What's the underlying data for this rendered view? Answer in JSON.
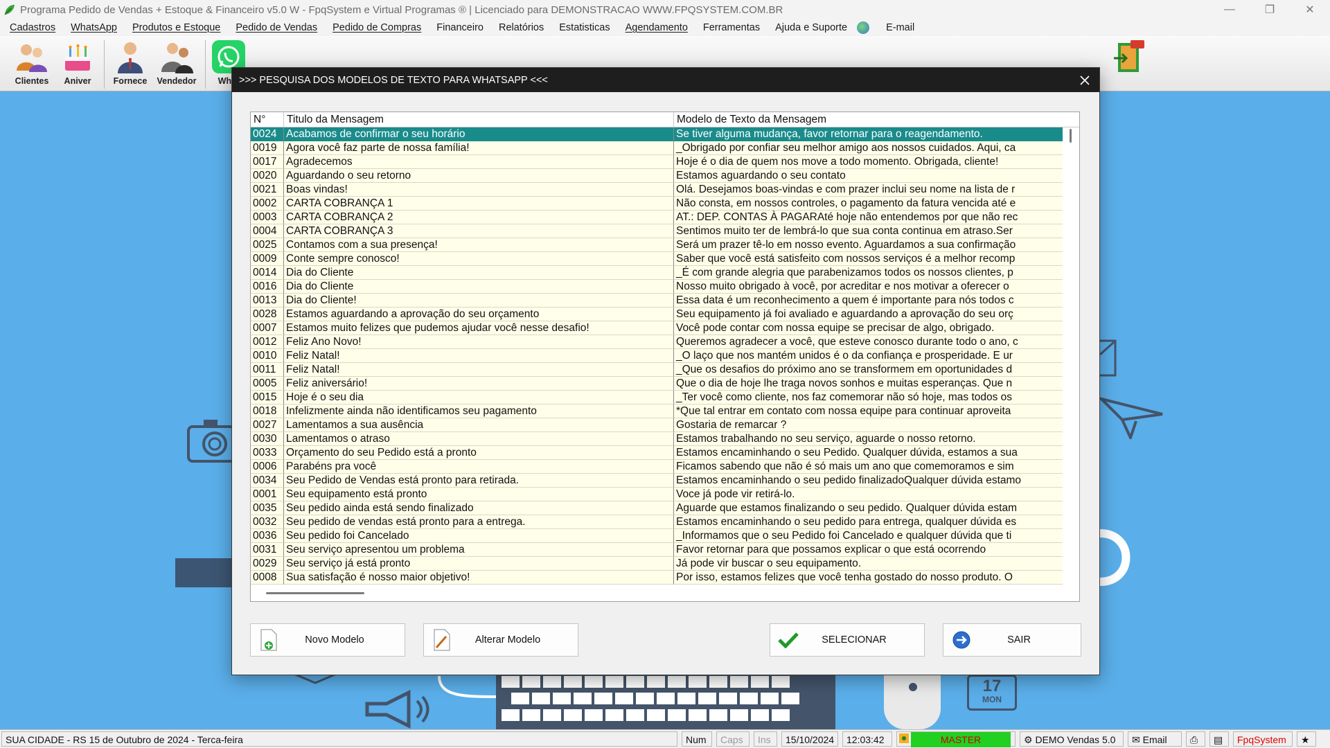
{
  "window": {
    "title": "Programa Pedido de Vendas + Estoque & Financeiro v5.0 W - FpqSystem e Virtual Programas ® | Licenciado para  DEMONSTRACAO WWW.FPQSYSTEM.COM.BR"
  },
  "menu": [
    "Cadastros",
    "WhatsApp",
    "Produtos e Estoque",
    "Pedido de Vendas",
    "Pedido de Compras",
    "Financeiro",
    "Relatórios",
    "Estatisticas",
    "Agendamento",
    "Ferramentas",
    "Ajuda e Suporte",
    "E-mail"
  ],
  "toolbar": {
    "clientes": "Clientes",
    "aniver": "Aniver",
    "fornece": "Fornece",
    "vendedor": "Vendedor",
    "whats": "What"
  },
  "dialog": {
    "title": ">>> PESQUISA DOS MODELOS DE TEXTO PARA WHATSAPP <<<",
    "columns": [
      "N°",
      "Titulo da Mensagem",
      "Modelo de Texto da Mensagem"
    ],
    "selected_index": 0,
    "rows": [
      {
        "n": "0024",
        "titulo": "Acabamos de confirmar o seu horário",
        "texto": "Se tiver alguma mudança, favor retornar para o reagendamento."
      },
      {
        "n": "0019",
        "titulo": "Agora você faz parte de nossa família!",
        "texto": "_Obrigado por confiar seu melhor amigo aos nossos cuidados. Aqui, ca"
      },
      {
        "n": "0017",
        "titulo": "Agradecemos",
        "texto": "Hoje é o dia de quem nos move a todo momento. Obrigada, cliente!"
      },
      {
        "n": "0020",
        "titulo": "Aguardando o seu retorno",
        "texto": "Estamos aguardando o seu contato"
      },
      {
        "n": "0021",
        "titulo": "Boas vindas!",
        "texto": "Olá. Desejamos boas-vindas e com prazer inclui seu nome na lista de r"
      },
      {
        "n": "0002",
        "titulo": "CARTA COBRANÇA 1",
        "texto": "Não consta, em nossos controles, o pagamento da fatura vencida até e"
      },
      {
        "n": "0003",
        "titulo": "CARTA COBRANÇA 2",
        "texto": "AT.: DEP. CONTAS À PAGARAté hoje não entendemos por que não rec"
      },
      {
        "n": "0004",
        "titulo": "CARTA COBRANÇA 3",
        "texto": "Sentimos muito ter de lembrá-lo que sua conta continua em atraso.Ser"
      },
      {
        "n": "0025",
        "titulo": "Contamos com a sua presença!",
        "texto": "Será um prazer tê-lo em nosso evento. Aguardamos a sua confirmação"
      },
      {
        "n": "0009",
        "titulo": "Conte sempre conosco!",
        "texto": "Saber que você está satisfeito com nossos serviços é a melhor recomp"
      },
      {
        "n": "0014",
        "titulo": "Dia do Cliente",
        "texto": "_É com grande alegria que parabenizamos todos os nossos clientes, p"
      },
      {
        "n": "0016",
        "titulo": "Dia do Cliente",
        "texto": "Nosso muito obrigado à você, por acreditar e nos motivar a oferecer o"
      },
      {
        "n": "0013",
        "titulo": "Dia do Cliente!",
        "texto": "Essa data é um reconhecimento a quem é importante para nós todos c"
      },
      {
        "n": "0028",
        "titulo": "Estamos aguardando a aprovação do seu orçamento",
        "texto": "Seu equipamento já foi avaliado e aguardando a aprovação do seu orç"
      },
      {
        "n": "0007",
        "titulo": "Estamos muito felizes que pudemos ajudar você nesse desafio!",
        "texto": "Você pode contar com nossa equipe se precisar de algo, obrigado."
      },
      {
        "n": "0012",
        "titulo": "Feliz Ano Novo!",
        "texto": "Queremos agradecer a você, que esteve conosco durante todo o ano, c"
      },
      {
        "n": "0010",
        "titulo": "Feliz Natal!",
        "texto": "_O laço que nos mantém unidos é o da confiança e prosperidade. E ur"
      },
      {
        "n": "0011",
        "titulo": "Feliz Natal!",
        "texto": "_Que os desafios do próximo ano se transformem em oportunidades d"
      },
      {
        "n": "0005",
        "titulo": "Feliz aniversário!",
        "texto": "Que o dia de hoje lhe traga novos sonhos e muitas esperanças. Que n"
      },
      {
        "n": "0015",
        "titulo": "Hoje é o seu dia",
        "texto": "_Ter você como cliente, nos faz comemorar não só hoje, mas todos os"
      },
      {
        "n": "0018",
        "titulo": "Infelizmente ainda não identificamos seu pagamento",
        "texto": "*Que tal entrar em contato com nossa equipe para continuar aproveita"
      },
      {
        "n": "0027",
        "titulo": "Lamentamos a sua ausência",
        "texto": "Gostaria de remarcar ?"
      },
      {
        "n": "0030",
        "titulo": "Lamentamos o atraso",
        "texto": "Estamos trabalhando no seu serviço, aguarde o nosso retorno."
      },
      {
        "n": "0033",
        "titulo": "Orçamento do seu Pedido está a pronto",
        "texto": "Estamos encaminhando o seu Pedido. Qualquer dúvida, estamos a sua"
      },
      {
        "n": "0006",
        "titulo": "Parabéns pra você",
        "texto": "Ficamos sabendo que não é só mais um ano que comemoramos e sim"
      },
      {
        "n": "0034",
        "titulo": "Seu Pedido de Vendas está pronto para retirada.",
        "texto": "Estamos encaminhando o seu pedido finalizadoQualquer dúvida estamo"
      },
      {
        "n": "0001",
        "titulo": "Seu equipamento está pronto",
        "texto": "Voce já pode vir retirá-lo."
      },
      {
        "n": "0035",
        "titulo": "Seu pedido ainda está sendo finalizado",
        "texto": "Aguarde que estamos finalizando o seu pedido. Qualquer dúvida estam"
      },
      {
        "n": "0032",
        "titulo": "Seu pedido de vendas está pronto para a entrega.",
        "texto": "Estamos encaminhando o seu pedido para entrega, qualquer dúvida es"
      },
      {
        "n": "0036",
        "titulo": "Seu pedido foi Cancelado",
        "texto": "_Informamos que o seu Pedido foi Cancelado e qualquer dúvida que ti"
      },
      {
        "n": "0031",
        "titulo": "Seu serviço apresentou um problema",
        "texto": "Favor retornar para que possamos explicar o que está ocorrendo"
      },
      {
        "n": "0029",
        "titulo": "Seu serviço já está pronto",
        "texto": "Já pode vir buscar o seu equipamento."
      },
      {
        "n": "0008",
        "titulo": "Sua satisfação é nosso maior objetivo!",
        "texto": "Por isso, estamos felizes que você tenha gostado do nosso produto. O"
      }
    ],
    "buttons": {
      "novo": "Novo Modelo",
      "alterar": "Alterar Modelo",
      "selecionar": "SELECIONAR",
      "sair": "SAIR"
    }
  },
  "statusbar": {
    "location": "SUA CIDADE - RS 15 de Outubro de 2024 - Terca-feira",
    "num": "Num",
    "caps": "Caps",
    "ins": "Ins",
    "date": "15/10/2024",
    "time": "12:03:42",
    "user": "MASTER",
    "version": "DEMO Vendas 5.0",
    "email": "Email",
    "brand": "FpqSystem"
  },
  "desktop": {
    "calendar_day": "17",
    "calendar_month": "MON"
  },
  "colors": {
    "desktop": "#5aaee9",
    "selected_row": "#1a8b8b",
    "row_bg": "#ffffe9",
    "master_bg": "#22d022"
  }
}
